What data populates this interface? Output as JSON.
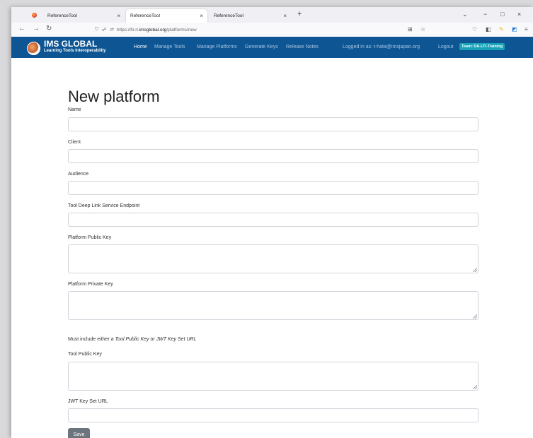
{
  "browser": {
    "tabs": [
      {
        "title": "ReferenceTool",
        "active": false
      },
      {
        "title": "ReferenceTool",
        "active": true
      },
      {
        "title": "ReferenceTool",
        "active": false
      }
    ],
    "tab_close": "×",
    "new_tab": "+",
    "url_prefix": "https://lti-ri.",
    "url_domain": "imsglobal.org",
    "url_path": "/platforms/new",
    "window_controls": {
      "minimize": "−",
      "restore": "□",
      "close": "×",
      "list": "⌄"
    }
  },
  "app": {
    "brand_title": "IMS GLOBAL",
    "brand_subtitle": "Learning Tools Interoperability",
    "nav": [
      {
        "label": "Home",
        "active": true
      },
      {
        "label": "Manage Tools",
        "active": false
      },
      {
        "label": "Manage Platforms",
        "active": false
      },
      {
        "label": "Generate Keys",
        "active": false
      },
      {
        "label": "Release Notes",
        "active": false
      }
    ],
    "logged_in_text": "Logged in as: t-hata@imsjapan.org",
    "logout_label": "Logout",
    "team_badge": "Team: DA-LTI-Training",
    "colors": {
      "header": "#0d5593",
      "badge": "#17a2b8",
      "save_button": "#6c757d"
    }
  },
  "form": {
    "title": "New platform",
    "fields": {
      "name": {
        "label": "Name",
        "value": ""
      },
      "client": {
        "label": "Client",
        "value": ""
      },
      "audience": {
        "label": "Audience",
        "value": ""
      },
      "deep_link": {
        "label": "Tool Deep Link Service Endpoint",
        "value": ""
      },
      "public_key": {
        "label": "Platform Public Key",
        "value": ""
      },
      "private_key": {
        "label": "Platform Private Key",
        "value": ""
      },
      "tool_public_key": {
        "label": "Tool Public Key",
        "value": ""
      },
      "jwks_url": {
        "label": "JWT Key Set URL",
        "value": ""
      }
    },
    "note_prefix": "Must include either a ",
    "note_em1": "Tool Public Key",
    "note_mid": " or ",
    "note_em2": "JWT Key Set URL",
    "save_label": "Save"
  }
}
